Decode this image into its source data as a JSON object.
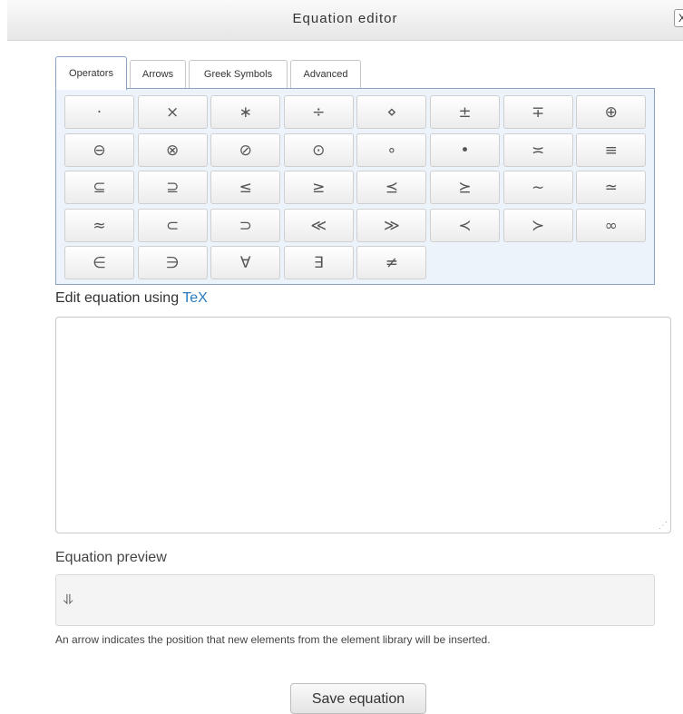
{
  "dialog": {
    "title": "Equation editor",
    "close_label": "X"
  },
  "tabs": [
    {
      "label": "Operators",
      "active": true
    },
    {
      "label": "Arrows",
      "active": false
    },
    {
      "label": "Greek Symbols",
      "active": false
    },
    {
      "label": "Advanced",
      "active": false
    }
  ],
  "operators": [
    {
      "symbol": "·",
      "name": "cdot"
    },
    {
      "symbol": "×",
      "name": "times"
    },
    {
      "symbol": "∗",
      "name": "ast"
    },
    {
      "symbol": "÷",
      "name": "div"
    },
    {
      "symbol": "⋄",
      "name": "diamond"
    },
    {
      "symbol": "±",
      "name": "pm"
    },
    {
      "symbol": "∓",
      "name": "mp"
    },
    {
      "symbol": "⊕",
      "name": "oplus"
    },
    {
      "symbol": "⊖",
      "name": "ominus"
    },
    {
      "symbol": "⊗",
      "name": "otimes"
    },
    {
      "symbol": "⊘",
      "name": "oslash"
    },
    {
      "symbol": "⊙",
      "name": "odot"
    },
    {
      "symbol": "∘",
      "name": "circ"
    },
    {
      "symbol": "•",
      "name": "bullet"
    },
    {
      "symbol": "≍",
      "name": "asymp"
    },
    {
      "symbol": "≡",
      "name": "equiv"
    },
    {
      "symbol": "⊆",
      "name": "subseteq"
    },
    {
      "symbol": "⊇",
      "name": "supseteq"
    },
    {
      "symbol": "≤",
      "name": "leq"
    },
    {
      "symbol": "≥",
      "name": "geq"
    },
    {
      "symbol": "⪯",
      "name": "preceq"
    },
    {
      "symbol": "⪰",
      "name": "succeq"
    },
    {
      "symbol": "∼",
      "name": "sim"
    },
    {
      "symbol": "≃",
      "name": "simeq"
    },
    {
      "symbol": "≈",
      "name": "approx"
    },
    {
      "symbol": "⊂",
      "name": "subset"
    },
    {
      "symbol": "⊃",
      "name": "supset"
    },
    {
      "symbol": "≪",
      "name": "ll"
    },
    {
      "symbol": "≫",
      "name": "gg"
    },
    {
      "symbol": "≺",
      "name": "prec"
    },
    {
      "symbol": "≻",
      "name": "succ"
    },
    {
      "symbol": "∞",
      "name": "infty"
    },
    {
      "symbol": "∈",
      "name": "in"
    },
    {
      "symbol": "∋",
      "name": "ni"
    },
    {
      "symbol": "∀",
      "name": "forall"
    },
    {
      "symbol": "∃",
      "name": "exists"
    },
    {
      "symbol": "≠",
      "name": "neq"
    }
  ],
  "editor": {
    "label_prefix": "Edit equation using ",
    "label_link": "TeX",
    "value": ""
  },
  "preview": {
    "label": "Equation preview",
    "cursor_symbol": "⥥",
    "hint": "An arrow indicates the position that new elements from the element library will be inserted."
  },
  "save_button": "Save equation",
  "colors": {
    "panel_bg": "#edf3fb",
    "panel_border": "#8aa3c4",
    "link": "#2a7bbf"
  }
}
